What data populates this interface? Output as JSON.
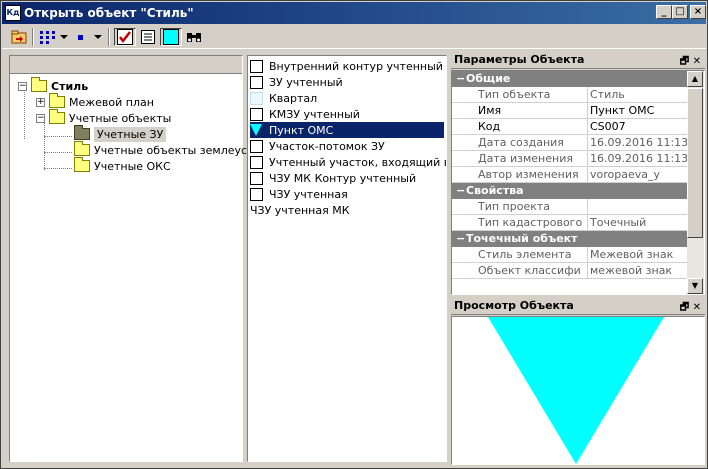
{
  "window": {
    "title": "Открыть объект \"Стиль\"",
    "icon_text": "Кд"
  },
  "title_buttons": {
    "minimize": "_",
    "maximize": "□",
    "close": "×"
  },
  "tree": {
    "root": "Стиль",
    "items": [
      {
        "label": "Межевой план",
        "expander": "+"
      },
      {
        "label": "Учетные объекты",
        "expander": "−"
      },
      {
        "label": "Учетные ЗУ"
      },
      {
        "label": "Учетные объекты землеуст"
      },
      {
        "label": "Учетные ОКС"
      }
    ]
  },
  "list": {
    "items": [
      {
        "label": "Внутренний контур учтенный",
        "symbol": "box"
      },
      {
        "label": "ЗУ учтенный",
        "symbol": "box"
      },
      {
        "label": "Квартал",
        "symbol": "light"
      },
      {
        "label": "КМЗУ учтенный",
        "symbol": "box"
      },
      {
        "label": "Пункт ОМС",
        "symbol": "tri"
      },
      {
        "label": "Участок-потомок ЗУ",
        "symbol": "box"
      },
      {
        "label": "Учтенный участок, входящий в",
        "symbol": "box"
      },
      {
        "label": "ЧЗУ МК Контур учтенный",
        "symbol": "box"
      },
      {
        "label": "ЧЗУ учтенная",
        "symbol": "box"
      },
      {
        "label": "ЧЗУ учтенная МК",
        "symbol": "none"
      }
    ],
    "selected_index": 4
  },
  "properties": {
    "title": "Параметры Объекта",
    "categories": [
      {
        "name": "Общие",
        "rows": [
          {
            "key": "Тип объекта",
            "value": "Стиль",
            "dark": false
          },
          {
            "key": "Имя",
            "value": "Пункт ОМС",
            "dark": true
          },
          {
            "key": "Код",
            "value": "CS007",
            "dark": true
          },
          {
            "key": "Дата создания",
            "value": "16.09.2016 11:13",
            "dark": false
          },
          {
            "key": "Дата изменения",
            "value": "16.09.2016 11:13",
            "dark": false
          },
          {
            "key": "Автор изменения",
            "value": "voropaeva_y",
            "dark": false
          }
        ]
      },
      {
        "name": "Свойства",
        "rows": [
          {
            "key": "Тип проекта",
            "value": "",
            "dark": false
          },
          {
            "key": "Тип кадастрового",
            "value": "Точечный",
            "dark": false
          }
        ]
      },
      {
        "name": "Точечный объект",
        "rows": [
          {
            "key": "Стиль элемента",
            "value": "Межевой знак",
            "dark": false
          },
          {
            "key": "Объект классифи",
            "value": "межевой знак",
            "dark": false
          }
        ]
      }
    ]
  },
  "preview": {
    "title": "Просмотр Объекта",
    "shape_color": "#00ffff"
  },
  "colors": {
    "selection": "#0a246a",
    "face": "#d4d0c8"
  }
}
